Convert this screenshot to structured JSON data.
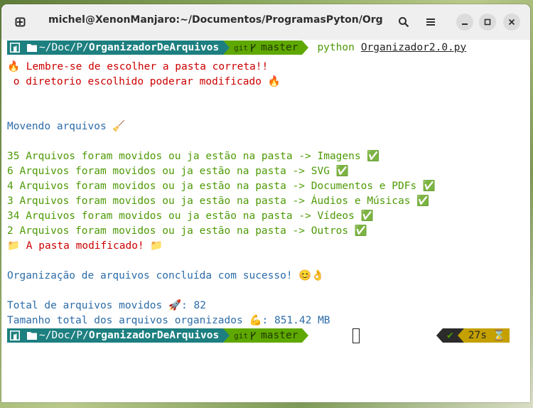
{
  "window": {
    "title": "michel@XenonManjaro:~/Documentos/ProgramasPyton/Org..."
  },
  "prompt1": {
    "path_prefix": "~/Doc/P/",
    "path_dir": "OrganizadorDeArquivos",
    "git_label": "git",
    "branch": "master",
    "command": "python",
    "argument": "Organizador2.0.py"
  },
  "output": {
    "warn1": "🔥 Lembre-se de escolher a pasta correta!!",
    "warn2": " o diretorio escolhido poderar modificado 🔥",
    "moving": "Movendo arquivos 🧹",
    "moved": [
      "35 Arquivos foram movidos ou ja estão na pasta -> Imagens ✅",
      "6 Arquivos foram movidos ou ja estão na pasta -> SVG ✅",
      "4 Arquivos foram movidos ou ja estão na pasta -> Documentos e PDFs ✅",
      "3 Arquivos foram movidos ou ja estão na pasta -> Áudios e Músicas ✅",
      "34 Arquivos foram movidos ou ja estão na pasta -> Vídeos ✅",
      "2 Arquivos foram movidos ou ja estão na pasta -> Outros ✅"
    ],
    "folder_modified": "📁 A pasta modificado! 📁",
    "done": "Organização de arquivos concluída com sucesso! 😊👌",
    "total": "Total de arquivos movidos 🚀: 82",
    "size": "Tamanho total dos arquivos organizados 💪: 851.42 MB"
  },
  "prompt2": {
    "path_prefix": "~/Doc/P/",
    "path_dir": "OrganizadorDeArquivos",
    "git_label": "git",
    "branch": "master",
    "status_ok": "✔",
    "duration": "27s",
    "hourglass": "⌛"
  },
  "colors": {
    "teal": "#1d7f80",
    "git_green": "#5fa800",
    "red_text": "#cc0000",
    "blue_text": "#2c6ca8",
    "green_text": "#4e9a06",
    "duration_bg": "#c4a000"
  },
  "icons": [
    "new-tab-icon",
    "search-icon",
    "menu-icon",
    "minimize-icon",
    "maximize-icon",
    "close-icon",
    "manjaro-icon",
    "folder-icon",
    "branch-icon"
  ]
}
